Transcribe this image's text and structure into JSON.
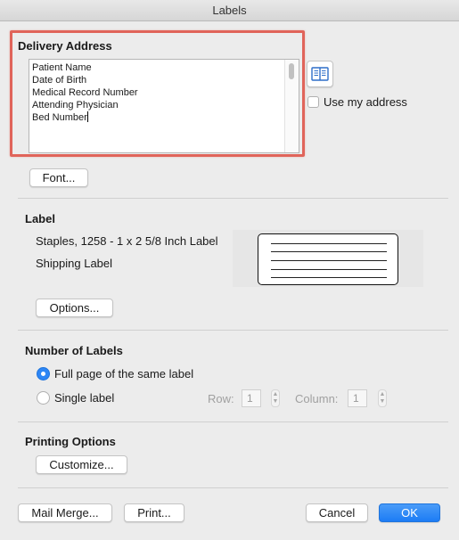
{
  "window": {
    "title": "Labels"
  },
  "delivery_address": {
    "heading": "Delivery Address",
    "lines": [
      "Patient Name",
      "Date of Birth",
      "Medical Record Number",
      "Attending Physician",
      "Bed Number"
    ],
    "use_my_address_label": "Use my address",
    "use_my_address_checked": false,
    "address_book_icon": "address-book-icon",
    "highlight_color": "#e0645a"
  },
  "font_button": "Font...",
  "label": {
    "heading": "Label",
    "product": "Staples, 1258 - 1 x 2 5/8 Inch Label",
    "type": "Shipping Label",
    "options_button": "Options..."
  },
  "number_of_labels": {
    "heading": "Number of Labels",
    "full_page_label": "Full page of the same label",
    "single_label": "Single label",
    "selected": "full_page",
    "row_label": "Row:",
    "row_value": "1",
    "column_label": "Column:",
    "column_value": "1"
  },
  "printing_options": {
    "heading": "Printing Options",
    "customize_button": "Customize..."
  },
  "footer": {
    "mail_merge_button": "Mail Merge...",
    "print_button": "Print...",
    "cancel_button": "Cancel",
    "ok_button": "OK",
    "accent_color": "#1c7cf5"
  }
}
